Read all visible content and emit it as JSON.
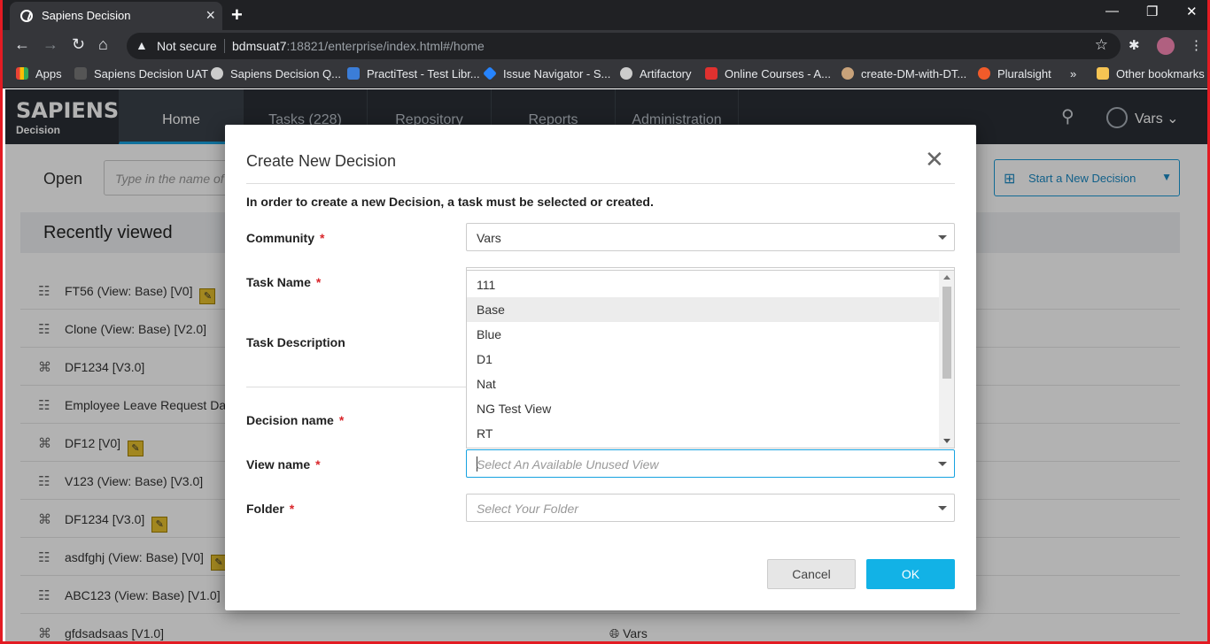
{
  "browser": {
    "tab_title": "Sapiens Decision",
    "not_secure_label": "Not secure",
    "url_host": "bdmsuat7",
    "url_rest": ":18821/enterprise/index.html#/home",
    "bookmarks": [
      {
        "label": "Apps",
        "color": "#4285f4"
      },
      {
        "label": "Sapiens Decision UAT",
        "color": "#555555"
      },
      {
        "label": "Sapiens Decision Q...",
        "color": "#cccccc"
      },
      {
        "label": "PractiTest - Test Libr...",
        "color": "#3b7dd8"
      },
      {
        "label": "Issue Navigator - S...",
        "color": "#2684ff"
      },
      {
        "label": "Artifactory",
        "color": "#cccccc"
      },
      {
        "label": "Online Courses - A...",
        "color": "#e0312f"
      },
      {
        "label": "create-DM-with-DT...",
        "color": "#c8a27a"
      },
      {
        "label": "Pluralsight",
        "color": "#f15b2a"
      }
    ],
    "more_bookmarks": "»",
    "other_bookmarks": "Other bookmarks"
  },
  "app": {
    "logo_main": "SAPIENS",
    "logo_sub": "Decision",
    "nav": [
      {
        "label": "Home"
      },
      {
        "label": "Tasks  (228)"
      },
      {
        "label": "Repository"
      },
      {
        "label": "Reports"
      },
      {
        "label": "Administration"
      }
    ],
    "user": "Vars",
    "accent_color": "#17a2e0"
  },
  "page": {
    "open_label": "Open",
    "open_placeholder": "Type in the name of",
    "start_button": "Start a New Decision",
    "recently_viewed": "Recently viewed",
    "rows": [
      {
        "name": "FT56 (View: Base) [V0]",
        "edit": true
      },
      {
        "name": "Clone (View: Base) [V2.0]",
        "edit": false
      },
      {
        "name": "DF1234 [V3.0]",
        "edit": false
      },
      {
        "name": "Employee Leave Request Da",
        "edit": false
      },
      {
        "name": "DF12 [V0]",
        "edit": true
      },
      {
        "name": "V123 (View: Base) [V3.0]",
        "edit": false
      },
      {
        "name": "DF1234 [V3.0]",
        "edit": true
      },
      {
        "name": "asdfghj (View: Base) [V0]",
        "edit": true
      },
      {
        "name": "ABC123 (View: Base) [V1.0]",
        "edit": false
      },
      {
        "name": "gfdsadsaas [V1.0]",
        "edit": false,
        "community": "Vars"
      }
    ]
  },
  "modal": {
    "title": "Create New Decision",
    "info": "In order to create a new Decision, a task must be selected or created.",
    "community_label": "Community",
    "community_value": "Vars",
    "task_name_label": "Task Name",
    "task_description_label": "Task Description",
    "decision_name_label": "Decision name",
    "view_name_label": "View name",
    "view_name_placeholder": "Select An Available Unused View",
    "folder_label": "Folder",
    "folder_placeholder": "Select Your Folder",
    "required_mark": "*",
    "dropdown_options": [
      "111",
      "Base",
      "Blue",
      "D1",
      "Nat",
      "NG Test View",
      "RT"
    ],
    "highlighted_option": "Base",
    "cancel": "Cancel",
    "ok": "OK"
  }
}
